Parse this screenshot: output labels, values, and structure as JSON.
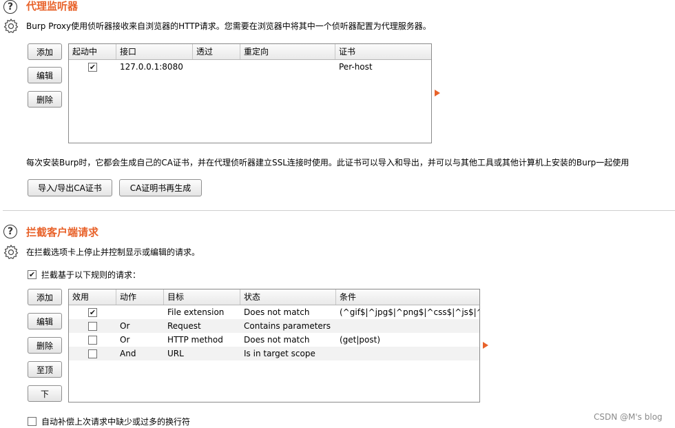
{
  "proxy_listeners": {
    "title": "代理监听器",
    "description": "Burp Proxy使用侦听器接收来自浏览器的HTTP请求。您需要在浏览器中将其中一个侦听器配置为代理服务器。",
    "buttons": {
      "add": "添加",
      "edit": "编辑",
      "remove": "删除"
    },
    "columns": [
      "起动中",
      "接口",
      "透过",
      "重定向",
      "证书"
    ],
    "rows": [
      {
        "running": true,
        "interface": "127.0.0.1:8080",
        "invisible": "",
        "redirect": "",
        "certificate": "Per-host"
      }
    ],
    "ca_text": "每次安装Burp时，它都会生成自己的CA证书，并在代理侦听器建立SSL连接时使用。此证书可以导入和导出，并可以与其他工具或其他计算机上安装的Burp一起使用",
    "import_export_ca": "导入/导出CA证书",
    "regenerate_ca": "CA证明书再生成"
  },
  "intercept_client": {
    "title": "拦截客户端请求",
    "description": "在拦截选项卡上停止并控制显示或编辑的请求。",
    "rule_checkbox_label": "拦截基于以下规则的请求：",
    "rule_checkbox_checked": true,
    "buttons": {
      "add": "添加",
      "edit": "编辑",
      "remove": "删除",
      "up": "至顶",
      "down": "下"
    },
    "columns": [
      "效用",
      "动作",
      "目标",
      "状态",
      "条件"
    ],
    "rows": [
      {
        "enabled": true,
        "op": "",
        "target": "File extension",
        "relationship": "Does not match",
        "condition": "(^gif$|^jpg$|^png$|^css$|^js$|^ico$)"
      },
      {
        "enabled": false,
        "op": "Or",
        "target": "Request",
        "relationship": "Contains parameters",
        "condition": ""
      },
      {
        "enabled": false,
        "op": "Or",
        "target": "HTTP method",
        "relationship": "Does not match",
        "condition": "(get|post)"
      },
      {
        "enabled": false,
        "op": "And",
        "target": "URL",
        "relationship": "Is in target scope",
        "condition": ""
      }
    ],
    "auto_fix_label": "自动补偿上次请求中缺少或过多的换行符",
    "auto_fix_checked": false
  },
  "watermark": "CSDN @M's blog",
  "colors": {
    "accent": "#e8622a"
  }
}
